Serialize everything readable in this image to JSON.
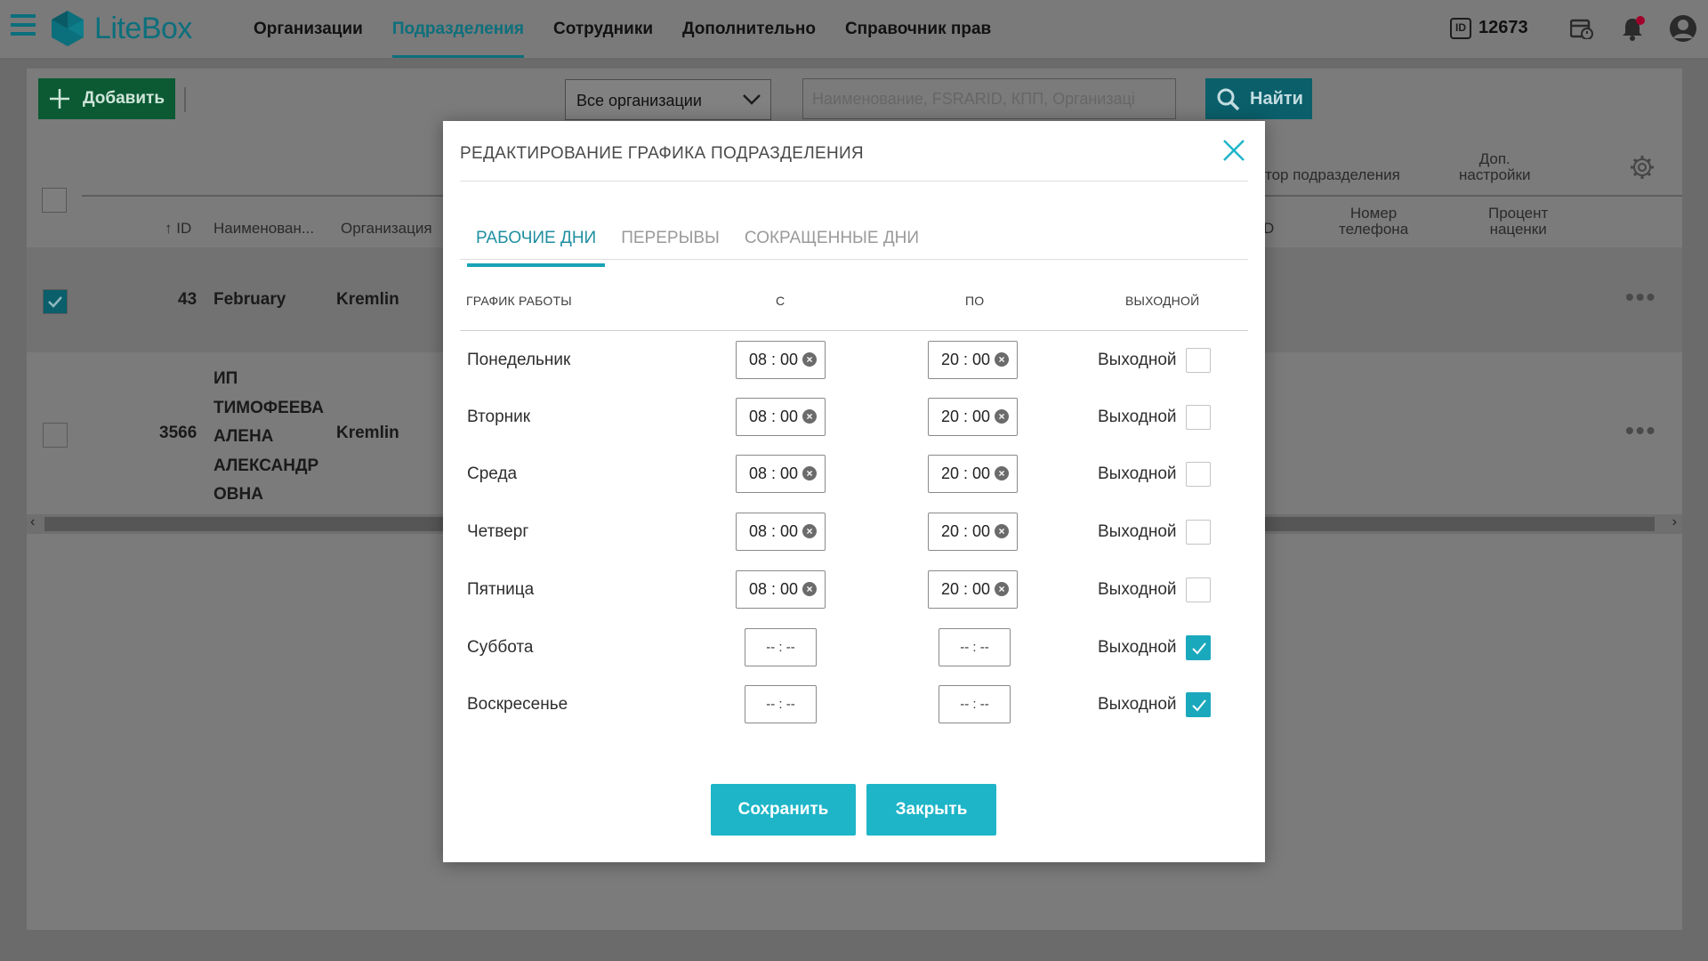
{
  "app": {
    "logo_text": "LiteBox",
    "accent_color": "#1eb5c8",
    "brand_color": "#0c6f7c"
  },
  "nav": [
    {
      "label": "Организации"
    },
    {
      "label": "Подразделения",
      "active": true
    },
    {
      "label": "Сотрудники"
    },
    {
      "label": "Дополнительно"
    },
    {
      "label": "Справочник прав"
    }
  ],
  "header": {
    "id_badge": "ID",
    "id_value": "12673",
    "icons": [
      "calendar-icon",
      "bell-icon",
      "user-icon"
    ]
  },
  "toolbar": {
    "add_label": "Добавить",
    "org_select_value": "Все организации",
    "search_placeholder": "Наименование, FSRARID, КПП, Организаці",
    "find_label": "Найти"
  },
  "table": {
    "headers": {
      "id": "ID",
      "name": "Наименован...",
      "org": "Организация",
      "director": "тор подразделения",
      "extra_settings": "Доп.\nнастройки",
      "phone": "Номер\nтелефона",
      "markup": "Процент\nнаценки",
      "hidden_id": "D"
    },
    "rows": [
      {
        "id": "43",
        "name": "February",
        "org": "Kremlin",
        "checked": true
      },
      {
        "id": "3566",
        "name": "ИП\nТИМОФЕЕВА\nАЛЕНА\nАЛЕКСАНДР\nОВНА",
        "org": "Kremlin",
        "checked": false
      }
    ],
    "row_menu": "•••"
  },
  "modal": {
    "title": "РЕДАКТИРОВАНИЕ ГРАФИКА ПОДРАЗДЕЛЕНИЯ",
    "tabs": [
      {
        "label": "РАБОЧИЕ ДНИ",
        "active": true
      },
      {
        "label": "ПЕРЕРЫВЫ"
      },
      {
        "label": "СОКРАЩЕННЫЕ ДНИ"
      }
    ],
    "columns": {
      "schedule": "ГРАФИК РАБОТЫ",
      "from": "С",
      "to": "ПО",
      "day_off": "ВЫХОДНОЙ"
    },
    "days": [
      {
        "name": "Понедельник",
        "from": "08 : 00",
        "to": "20 : 00",
        "day_off_label": "Выходной",
        "day_off": false
      },
      {
        "name": "Вторник",
        "from": "08 : 00",
        "to": "20 : 00",
        "day_off_label": "Выходной",
        "day_off": false
      },
      {
        "name": "Среда",
        "from": "08 : 00",
        "to": "20 : 00",
        "day_off_label": "Выходной",
        "day_off": false
      },
      {
        "name": "Четверг",
        "from": "08 : 00",
        "to": "20 : 00",
        "day_off_label": "Выходной",
        "day_off": false
      },
      {
        "name": "Пятница",
        "from": "08 : 00",
        "to": "20 : 00",
        "day_off_label": "Выходной",
        "day_off": false
      },
      {
        "name": "Суббота",
        "from": "-- : --",
        "to": "-- : --",
        "day_off_label": "Выходной",
        "day_off": true
      },
      {
        "name": "Воскресенье",
        "from": "-- : --",
        "to": "-- : --",
        "day_off_label": "Выходной",
        "day_off": true
      }
    ],
    "save_label": "Сохранить",
    "close_label": "Закрыть"
  }
}
